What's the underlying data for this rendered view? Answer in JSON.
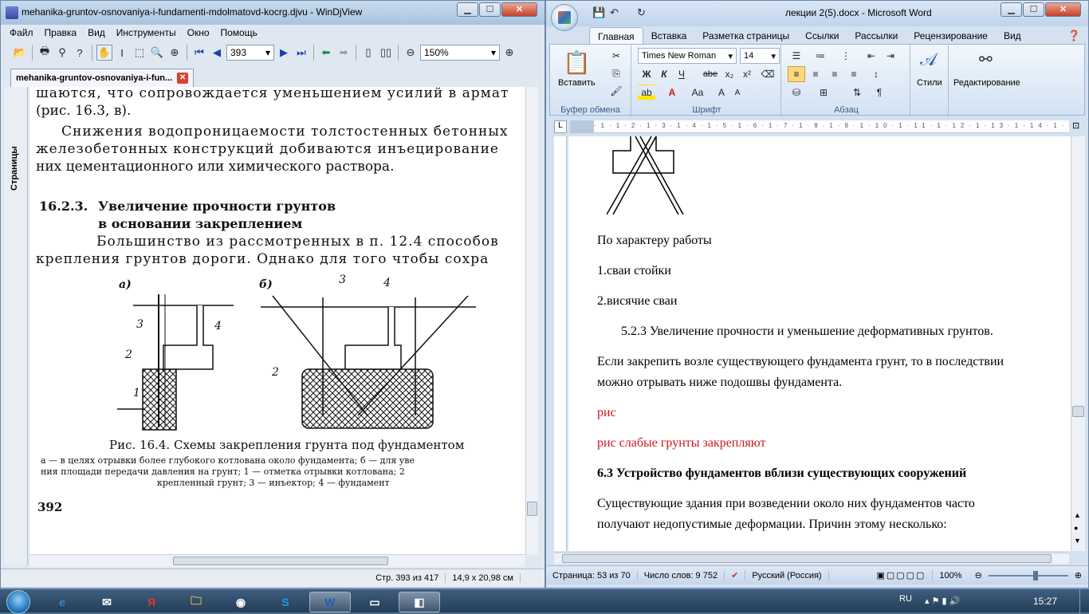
{
  "djvu": {
    "title": "mehanika-gruntov-osnovaniya-i-fundamenti-mdolmatovd-kocrg.djvu - WinDjView",
    "menu": [
      "Файл",
      "Правка",
      "Вид",
      "Инструменты",
      "Окно",
      "Помощь"
    ],
    "page_input": "393",
    "zoom": "150%",
    "tab_label": "mehanika-gruntov-osnovaniya-i-fun...",
    "side_tab": "Страницы",
    "page_text": {
      "l1": "шаются, что сопровождается уменьшением усилий в армат",
      "l2": "(рис. 16.3, в).",
      "l3": "Снижения водопроницаемости толстостенных бетонных",
      "l4": "железобетонных конструкций добиваются инъецирование",
      "l5": "них цементационного или химического раствора.",
      "sec_num": "16.2.3.",
      "sec_title1": "Увеличение прочности грунтов",
      "sec_title2": "в основании закреплением",
      "l6": "Большинство из рассмотренных в п. 12.4 способов",
      "l7": "крепления грунтов дороги. Однако для того чтобы сохра",
      "fig_a": "а)",
      "fig_b": "б)",
      "n1": "1",
      "n2": "2",
      "n3": "3",
      "n4": "4",
      "caption": "Рис. 16.4. Схемы закрепления грунта под фундаментом",
      "cap2": "а — в целях отрывки более глубокого котлована около фундамента; б — для уве",
      "cap3": "ния площади передачи давления на грунт; 1 — отметка отрывки котлована; 2",
      "cap4": "крепленный грунт; 3 — инъектор; 4 — фундамент",
      "pagenum": "392"
    },
    "status_page": "Стр. 393 из 417",
    "status_size": "14,9 x 20,98 см"
  },
  "word": {
    "title": "лекции 2(5).docx - Microsoft Word",
    "tabs": [
      "Главная",
      "Вставка",
      "Разметка страницы",
      "Ссылки",
      "Рассылки",
      "Рецензирование",
      "Вид"
    ],
    "paste_label": "Вставить",
    "font_name": "Times New Roman",
    "font_size": "14",
    "styles_label": "Стили",
    "editing_label": "Редактирование",
    "groups": {
      "clipboard": "Буфер обмена",
      "font": "Шрифт",
      "paragraph": "Абзац"
    },
    "doc": {
      "p1": "По характеру работы",
      "p2": "1.сваи стойки",
      "p3": "2.висячие сваи",
      "p4": "5.2.3  Увеличение прочности и уменьшение деформативных грунтов.",
      "p5": "Если закрепить возле существующего фундамента грунт, то в последствии",
      "p6": "можно отрывать ниже подошвы фундамента.",
      "p7": "рис",
      "p8": "рис слабые грунты закрепляют",
      "p9": "6.3 Устройство фундаментов вблизи существующих сооружений",
      "p10": "Существующие здания при возведении около них фундаментов часто",
      "p11": "получают недопустимые деформации. Причин этому несколько:"
    },
    "status": {
      "page": "Страница: 53 из 70",
      "words": "Число слов: 9 752",
      "lang": "Русский (Россия)",
      "zoom": "100%"
    },
    "colors": {
      "red_text": "#d0141b",
      "ribbon": "#d3e1f1"
    }
  },
  "taskbar": {
    "apps": [
      "start-orb",
      "ie",
      "outlook",
      "yandex",
      "explorer",
      "chrome",
      "skype",
      "word",
      "windows",
      "windjview"
    ],
    "yandex_glyph": "Я",
    "skype_glyph": "S",
    "word_glyph": "W",
    "lang": "RU",
    "time": "15:27"
  }
}
